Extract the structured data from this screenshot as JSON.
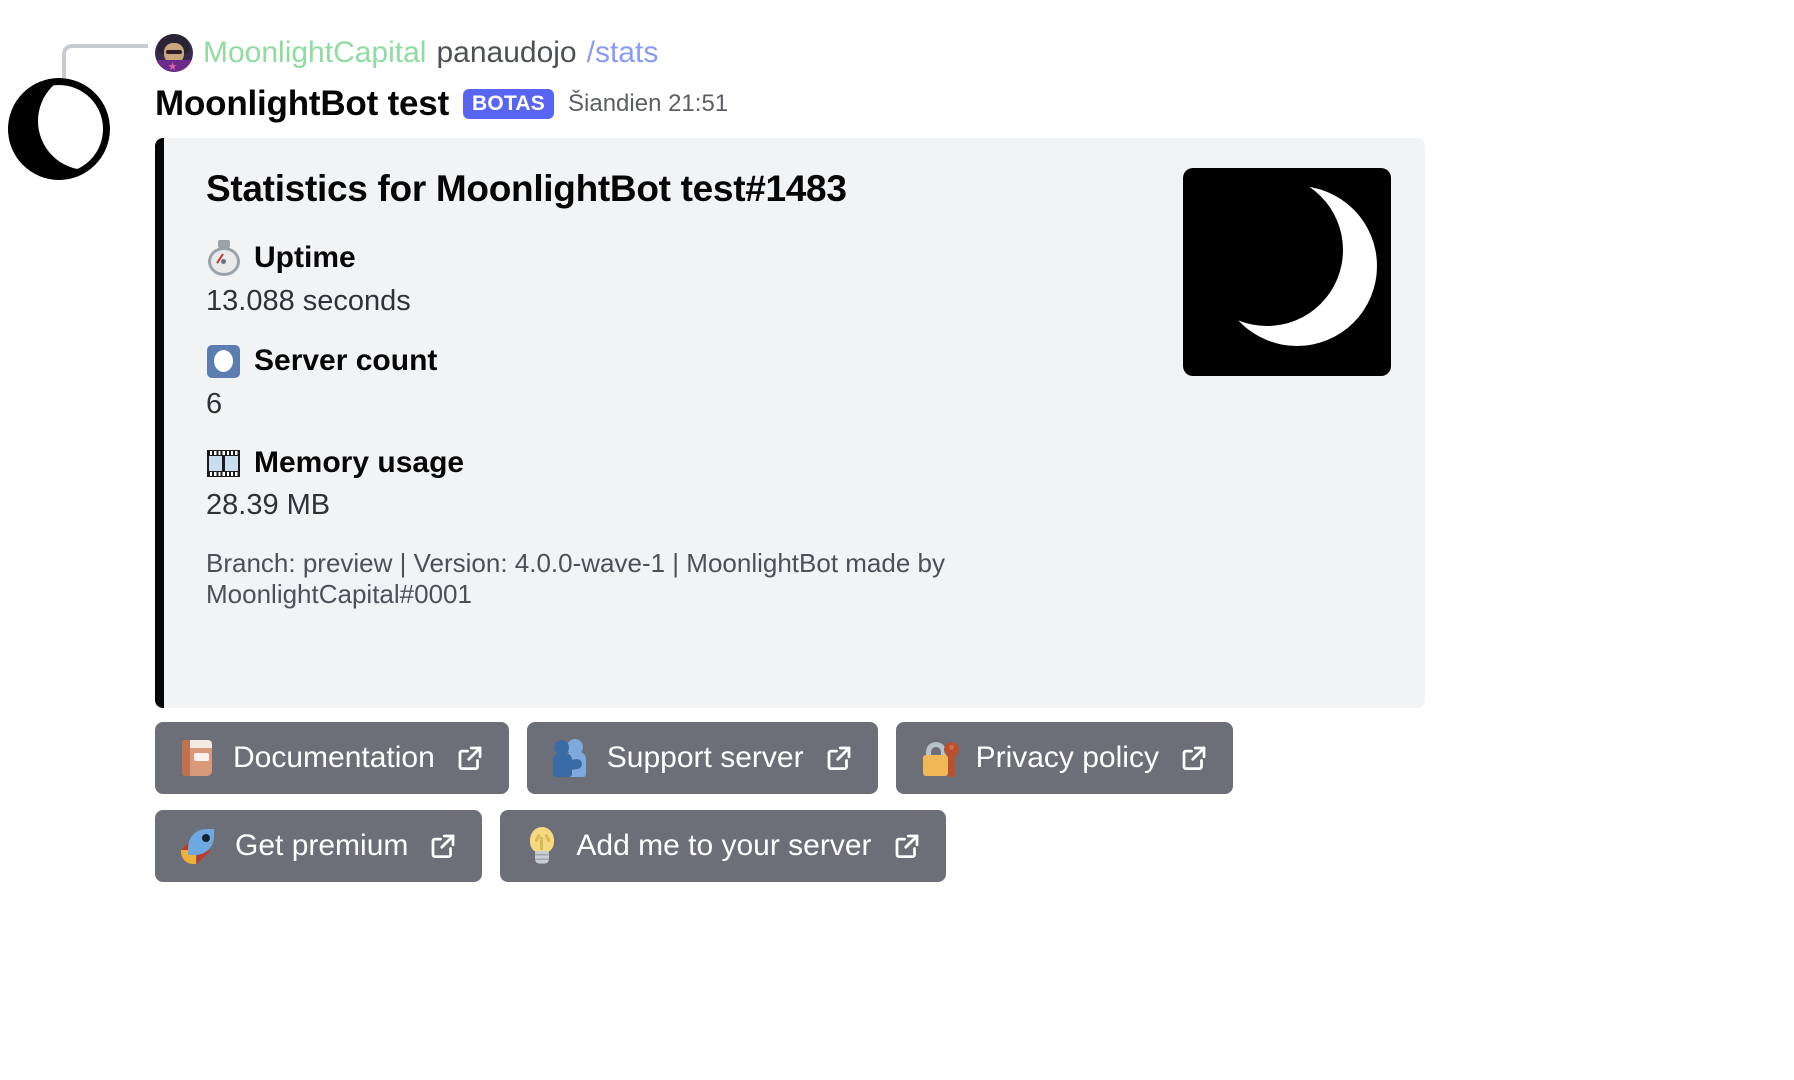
{
  "reply_reference": {
    "avatar_name": "moonlightcapital-avatar",
    "username": "MoonlightCapital",
    "verb": "panaudojo",
    "command": "/stats",
    "username_color": "#8fdca0",
    "command_color": "#8a9bf5"
  },
  "message": {
    "avatar_name": "moonlightbot-avatar",
    "author": "MoonlightBot test",
    "bot_badge": "BOTAS",
    "bot_badge_color": "#5865f2",
    "timestamp": "Šiandien 21:51"
  },
  "embed": {
    "accent_color": "#060607",
    "background": "#f2f3f5",
    "title": "Statistics for MoonlightBot test#1483",
    "thumbnail_name": "moon-logo-thumbnail",
    "fields": [
      {
        "icon": "stopwatch-icon",
        "name": "Uptime",
        "value": "13.088 seconds"
      },
      {
        "icon": "blue-square-icon",
        "name": "Server count",
        "value": "6"
      },
      {
        "icon": "film-frames-icon",
        "name": "Memory usage",
        "value": "28.39 MB"
      }
    ],
    "footer": "Branch: preview | Version: 4.0.0-wave-1 | MoonlightBot made by MoonlightCapital#0001"
  },
  "buttons": {
    "background": "#6d6f78",
    "rows": [
      [
        {
          "icon": "book-icon",
          "label": "Documentation",
          "link_icon": "external-link-icon"
        },
        {
          "icon": "people-hugging-icon",
          "label": "Support server",
          "link_icon": "external-link-icon"
        },
        {
          "icon": "locked-with-key-icon",
          "label": "Privacy policy",
          "link_icon": "external-link-icon"
        }
      ],
      [
        {
          "icon": "rocket-icon",
          "label": "Get premium",
          "link_icon": "external-link-icon"
        },
        {
          "icon": "light-bulb-icon",
          "label": "Add me to your server",
          "link_icon": "external-link-icon"
        }
      ]
    ]
  }
}
